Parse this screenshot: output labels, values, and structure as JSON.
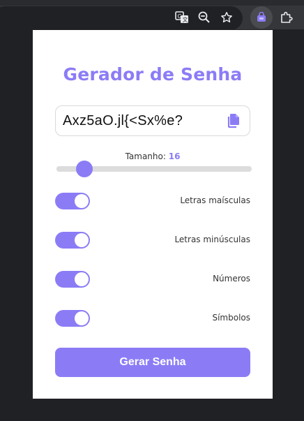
{
  "browser": {
    "toolbar_icons": [
      "translate-icon",
      "zoom-out-icon",
      "bookmark-star-icon",
      "extension-app-icon",
      "extensions-puzzle-icon"
    ]
  },
  "popup": {
    "title": "Gerador de Senha",
    "password": "Axz5aO.jl{<Sx%e?",
    "length_label": "Tamanho:",
    "length_value": "16",
    "length_min": 8,
    "length_max": 64,
    "options": [
      {
        "label": "Letras maísculas",
        "enabled": true
      },
      {
        "label": "Letras minúsculas",
        "enabled": true
      },
      {
        "label": "Números",
        "enabled": true
      },
      {
        "label": "Símbolos",
        "enabled": true
      }
    ],
    "generate_label": "Gerar Senha"
  },
  "colors": {
    "accent": "#8b7cf6",
    "browser_bg": "#202124",
    "toolbar_bg": "#35363a"
  }
}
